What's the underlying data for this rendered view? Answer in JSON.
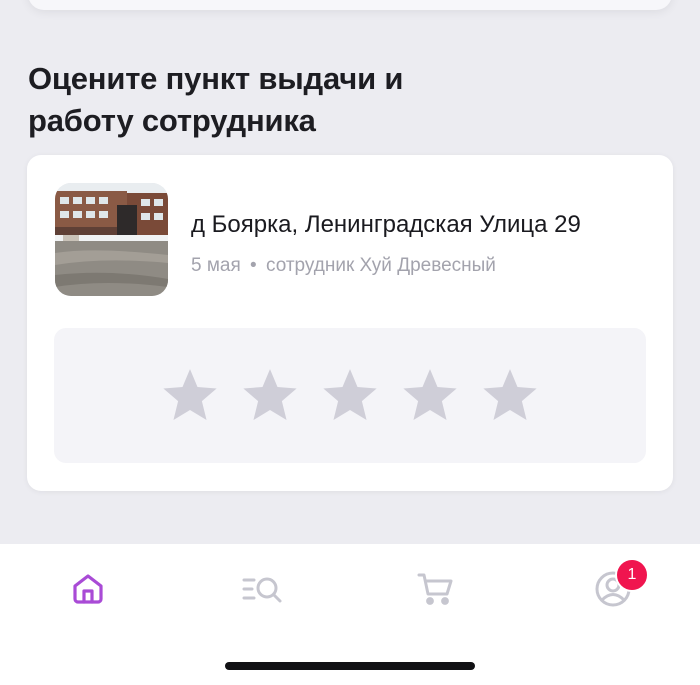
{
  "section": {
    "title_line1": "Оцените пункт выдачи и",
    "title_line2": "работу сотрудника"
  },
  "review_card": {
    "address": "д Боярка, Ленинградская Улица 29",
    "date": "5 мая",
    "separator": "•",
    "employee": "сотрудник Хуй Древесный",
    "photo_icon": "pickup-point-photo"
  },
  "rating": {
    "max_stars": 5,
    "selected": 0,
    "star_color": "#cfced8"
  },
  "tabbar": {
    "tabs": [
      {
        "name": "home",
        "icon": "home-icon",
        "active": true
      },
      {
        "name": "catalog",
        "icon": "catalog-search-icon",
        "active": false
      },
      {
        "name": "cart",
        "icon": "cart-icon",
        "active": false
      },
      {
        "name": "profile",
        "icon": "profile-icon",
        "active": false
      }
    ],
    "profile_badge": "1"
  },
  "colors": {
    "accent": "#a94bd6",
    "inactive_icon": "#c6c6cf",
    "badge": "#f0154f",
    "background": "#ececf1"
  }
}
